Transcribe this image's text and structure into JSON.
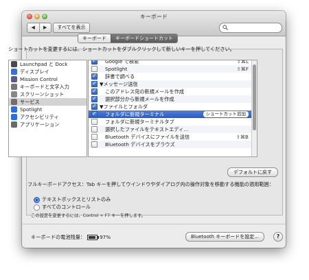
{
  "window": {
    "title": "キーボード"
  },
  "toolbar": {
    "back": "◀",
    "forward": "▶",
    "show_all": "すべてを表示"
  },
  "tabs": [
    {
      "label": "キーボード"
    },
    {
      "label": "キーボードショートカット"
    }
  ],
  "instruction": "ショートカットを変更するには、ショートカットをダブルクリックして新しいキーを押してください。",
  "categories": [
    {
      "label": "Launchpad と Dock",
      "color": "#4a4a4a"
    },
    {
      "label": "ディスプレイ",
      "color": "#3a6fd0"
    },
    {
      "label": "Mission Control",
      "color": "#5a5a8a"
    },
    {
      "label": "キーボードと文字入力",
      "color": "#777777"
    },
    {
      "label": "スクリーンショット",
      "color": "#888888"
    },
    {
      "label": "サービス",
      "color": "#6f6f6f"
    },
    {
      "label": "Spotlight",
      "color": "#2d6fd6"
    },
    {
      "label": "アクセシビリティ",
      "color": "#2d6fd6"
    },
    {
      "label": "アプリケーション",
      "color": "#6a6a6a"
    }
  ],
  "shortcuts": [
    {
      "label": "Google で検索",
      "checked": true,
      "key": "⇧⌘L"
    },
    {
      "label": "Spotlight",
      "checked": false,
      "key": "⇧⌘F"
    },
    {
      "label": "辞書で調べる",
      "checked": true,
      "key": ""
    },
    {
      "label": "▼メッセージ送信",
      "checked": true,
      "key": "",
      "group": true
    },
    {
      "label": "このアドレス宛の新規メールを作成",
      "checked": true,
      "key": ""
    },
    {
      "label": "選択部分から新規メールを作成",
      "checked": true,
      "key": ""
    },
    {
      "label": "▼ファイルとフォルダ",
      "checked": true,
      "key": "",
      "group": true
    },
    {
      "label": "フォルダに新規ターミナル",
      "checked": true,
      "key": "",
      "selected": true,
      "pill": "ショートカット追加"
    },
    {
      "label": "フォルダに新規ターミナルタブ",
      "checked": false,
      "key": ""
    },
    {
      "label": "選択したファイルをテキストエディ…",
      "checked": false,
      "key": ""
    },
    {
      "label": "Bluetooth デバイスにファイルを送信",
      "checked": false,
      "key": "⇧⌘B"
    },
    {
      "label": "Bluetooth デバイスをブラウズ",
      "checked": false,
      "key": ""
    }
  ],
  "reset_button": "デフォルトに戻す",
  "full_keyboard_access": "フルキーボードアクセス：Tab キーを押してウインドウやダイアログ内の操作対象を移動する機能の適用範囲：",
  "radio_options": [
    {
      "label": "テキストボックスとリストのみ",
      "selected": true
    },
    {
      "label": "すべてのコントロール",
      "selected": false
    }
  ],
  "note": "この設定を変更するには、Control + F7 キーを押します。",
  "battery": {
    "label": "キーボードの電池残量：",
    "level": "97%"
  },
  "bluetooth_button": "Bluetooth キーボードを設定...",
  "help": "?"
}
